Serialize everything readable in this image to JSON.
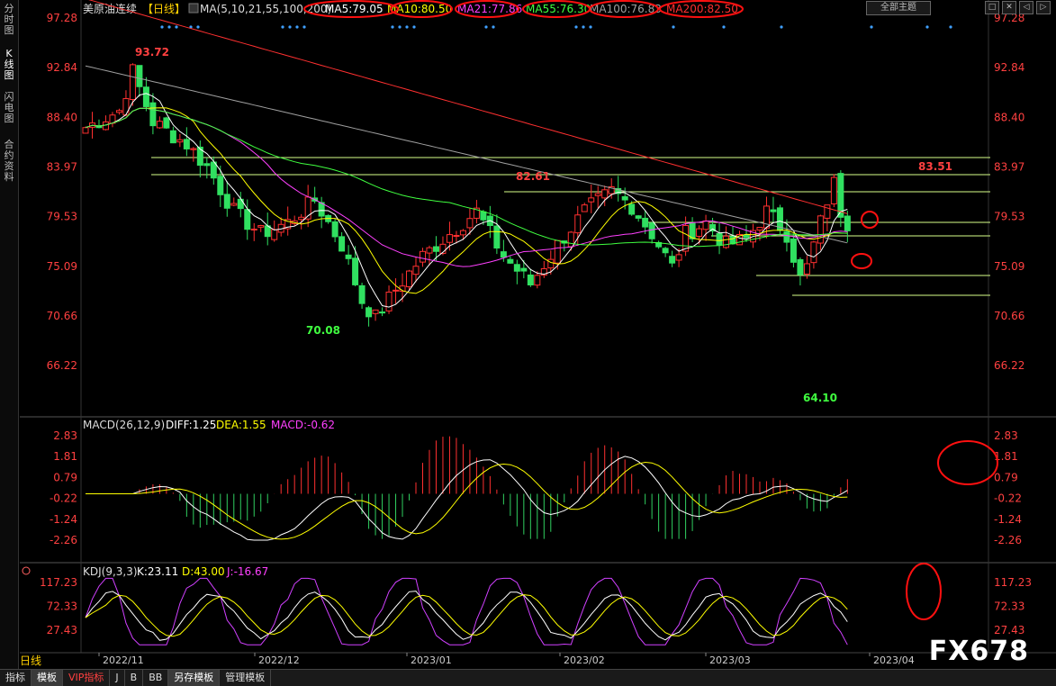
{
  "left_nav": [
    {
      "name": "nav-fenshi",
      "chars": [
        "分",
        "时",
        "图"
      ],
      "active": false
    },
    {
      "name": "nav-kline",
      "chars": [
        "K",
        "线",
        "图"
      ],
      "active": true
    },
    {
      "name": "nav-flash",
      "chars": [
        "闪",
        "电",
        "图"
      ],
      "active": false
    },
    {
      "name": "nav-contract",
      "chars": [
        "合",
        "约",
        "资",
        "料"
      ],
      "active": false
    }
  ],
  "header": {
    "symbol": "美原油连续",
    "period": "【日线】",
    "ma_label": "MA(5,10,21,55,100,200)",
    "ma5": "MA5:79.05",
    "ma10": "MA10:80.50",
    "ma21": "MA21:77.86",
    "ma55": "MA55:76.30",
    "ma100": "MA100:76.83",
    "ma200": "MA200:82.50",
    "theme_btn": "全部主题",
    "colors": {
      "ma5": "#ffffff",
      "ma10": "#ffff00",
      "ma21": "#ff40ff",
      "ma55": "#40ff40",
      "ma100": "#a0a0a0",
      "ma200": "#ff3030"
    }
  },
  "window_buttons": [
    "□",
    "✕",
    "◁",
    "▷"
  ],
  "price_axis": [
    "97.28",
    "92.84",
    "88.40",
    "83.97",
    "79.53",
    "75.09",
    "70.66",
    "66.22"
  ],
  "price_annotations": [
    {
      "label": "93.72",
      "color": "#ff4040"
    },
    {
      "label": "70.08",
      "color": "#40ff40"
    },
    {
      "label": "82.61",
      "color": "#ff4040"
    },
    {
      "label": "64.10",
      "color": "#40ff40"
    },
    {
      "label": "83.51",
      "color": "#ff4040"
    }
  ],
  "macd": {
    "label": "MACD(26,12,9)",
    "diff": "DIFF:1.25",
    "dea": "DEA:1.55",
    "macd": "MACD:-0.62",
    "axis": [
      "2.83",
      "1.81",
      "0.79",
      "-0.22",
      "-1.24",
      "-2.26"
    ]
  },
  "kdj": {
    "label": "KDJ(9,3,3)",
    "k": "K:23.11",
    "d": "D:43.00",
    "j": "J:-16.67",
    "axis": [
      "117.23",
      "72.33",
      "27.43"
    ]
  },
  "date_axis": [
    "2022/11",
    "2022/12",
    "2023/01",
    "2023/02",
    "2023/03",
    "2023/04"
  ],
  "period_label": "日线",
  "bottom_tabs": [
    {
      "label": "指标",
      "active": false,
      "vip": false
    },
    {
      "label": "模板",
      "active": true,
      "vip": false
    },
    {
      "label": "VIP指标",
      "active": false,
      "vip": true
    },
    {
      "label": "J",
      "active": false,
      "vip": false
    },
    {
      "label": "B",
      "active": false,
      "vip": false
    },
    {
      "label": "BB",
      "active": false,
      "vip": false
    },
    {
      "label": "另存模板",
      "active": true,
      "vip": false
    },
    {
      "label": "管理模板",
      "active": false,
      "vip": false
    }
  ],
  "watermark": "FX678"
}
